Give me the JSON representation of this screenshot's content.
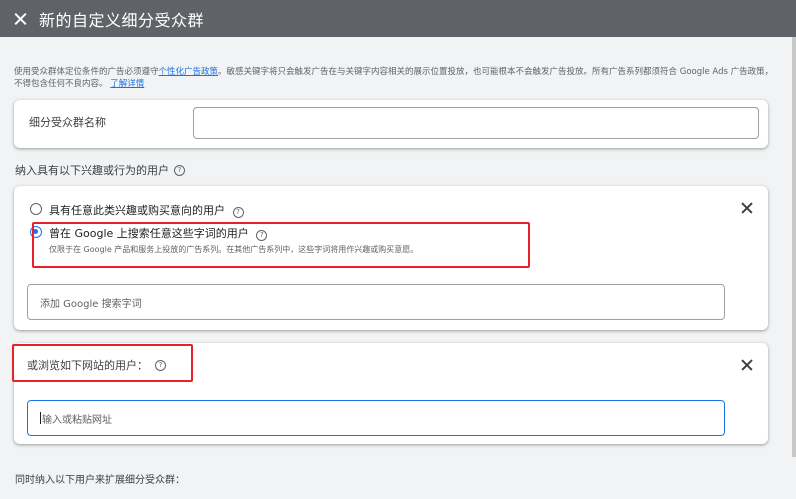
{
  "topbar": {
    "title": "新的自定义细分受众群",
    "close_icon": "close-icon"
  },
  "notice": {
    "text_part1": "使用受众群体定位条件的广告必须遵守",
    "link1": "个性化广告政策",
    "text_part2": "。敏感关键字将只会触发广告在与关键字内容相关的展示位置投放，也可能根本不会触发广告投放。所有广告系列都须符合 Google Ads 广告政策，不得包含任何不良内容。",
    "link2": "了解详情"
  },
  "segment_name": {
    "label": "细分受众群名称",
    "value": ""
  },
  "interests_section": {
    "label": "纳入具有以下兴趣或行为的用户",
    "options": [
      {
        "label": "具有任意此类兴趣或购买意向的用户",
        "selected": false
      },
      {
        "label": "曾在 Google 上搜索任意这些字词的用户",
        "selected": true,
        "description": "仅限于在 Google 产品和服务上投放的广告系列。在其他广告系列中，这些字词将用作兴趣或购买意愿。"
      }
    ],
    "search_terms_placeholder": "添加 Google 搜索字词"
  },
  "websites_section": {
    "label": "或浏览如下网站的用户：",
    "url_placeholder": "输入或粘贴网址"
  },
  "expand_section": {
    "label": "同时纳入以下用户来扩展细分受众群："
  },
  "colors": {
    "topbar": "#5f6368",
    "accent": "#1a73e8",
    "highlight": "#e8202a",
    "background": "#f1f3f4"
  }
}
